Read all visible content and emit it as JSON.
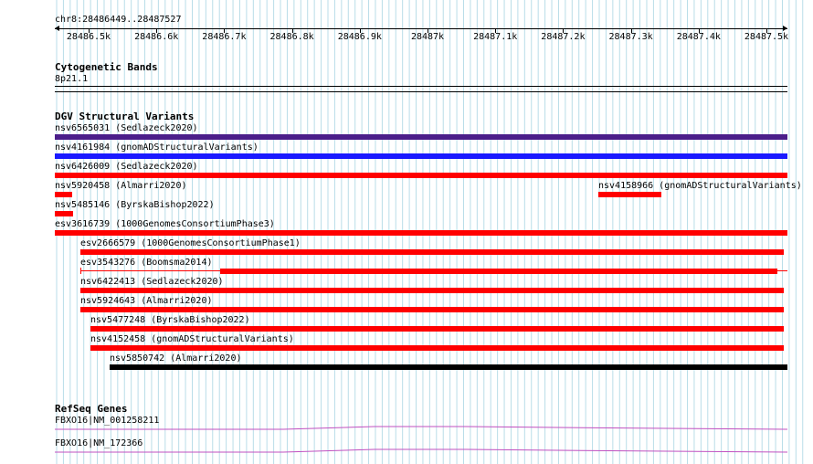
{
  "ruler": {
    "coord_label": "chr8:28486449..28487527",
    "ticks": [
      "28486.5k",
      "28486.6k",
      "28486.7k",
      "28486.8k",
      "28486.9k",
      "28487k",
      "28487.1k",
      "28487.2k",
      "28487.3k",
      "28487.4k",
      "28487.5k"
    ]
  },
  "cytobands": {
    "title": "Cytogenetic Bands",
    "band": "8p21.1"
  },
  "dgv": {
    "title": "DGV Structural Variants",
    "variants": [
      {
        "label": "nsv6565031 (Sedlazeck2020)",
        "color": "#4b1e8a"
      },
      {
        "label": "nsv4161984 (gnomADStructuralVariants)",
        "color": "#1a1aff"
      },
      {
        "label": "nsv6426009 (Sedlazeck2020)",
        "color": "#ff0000"
      },
      {
        "label": "nsv5920458 (Almarri2020)",
        "color": "#ff0000"
      },
      {
        "label": "nsv4158966 (gnomADStructuralVariants)",
        "color": "#ff0000"
      },
      {
        "label": "nsv5485146 (ByrskaBishop2022)",
        "color": "#ff0000"
      },
      {
        "label": "esv3616739 (1000GenomesConsortiumPhase3)",
        "color": "#ff0000"
      },
      {
        "label": "esv2666579 (1000GenomesConsortiumPhase1)",
        "color": "#ff0000"
      },
      {
        "label": "esv3543276 (Boomsma2014)",
        "color": "#ff0000"
      },
      {
        "label": "nsv6422413 (Sedlazeck2020)",
        "color": "#ff0000"
      },
      {
        "label": "nsv5924643 (Almarri2020)",
        "color": "#ff0000"
      },
      {
        "label": "nsv5477248 (ByrskaBishop2022)",
        "color": "#ff0000"
      },
      {
        "label": "nsv4152458 (gnomADStructuralVariants)",
        "color": "#ff0000"
      },
      {
        "label": "nsv5850742 (Almarri2020)",
        "color": "#000000"
      }
    ]
  },
  "refseq": {
    "title": "RefSeq Genes",
    "genes": [
      {
        "label": "FBXO16|NM_001258211",
        "color": "#c050c0"
      },
      {
        "label": "FBXO16|NM_172366",
        "color": "#c050c0"
      }
    ]
  }
}
